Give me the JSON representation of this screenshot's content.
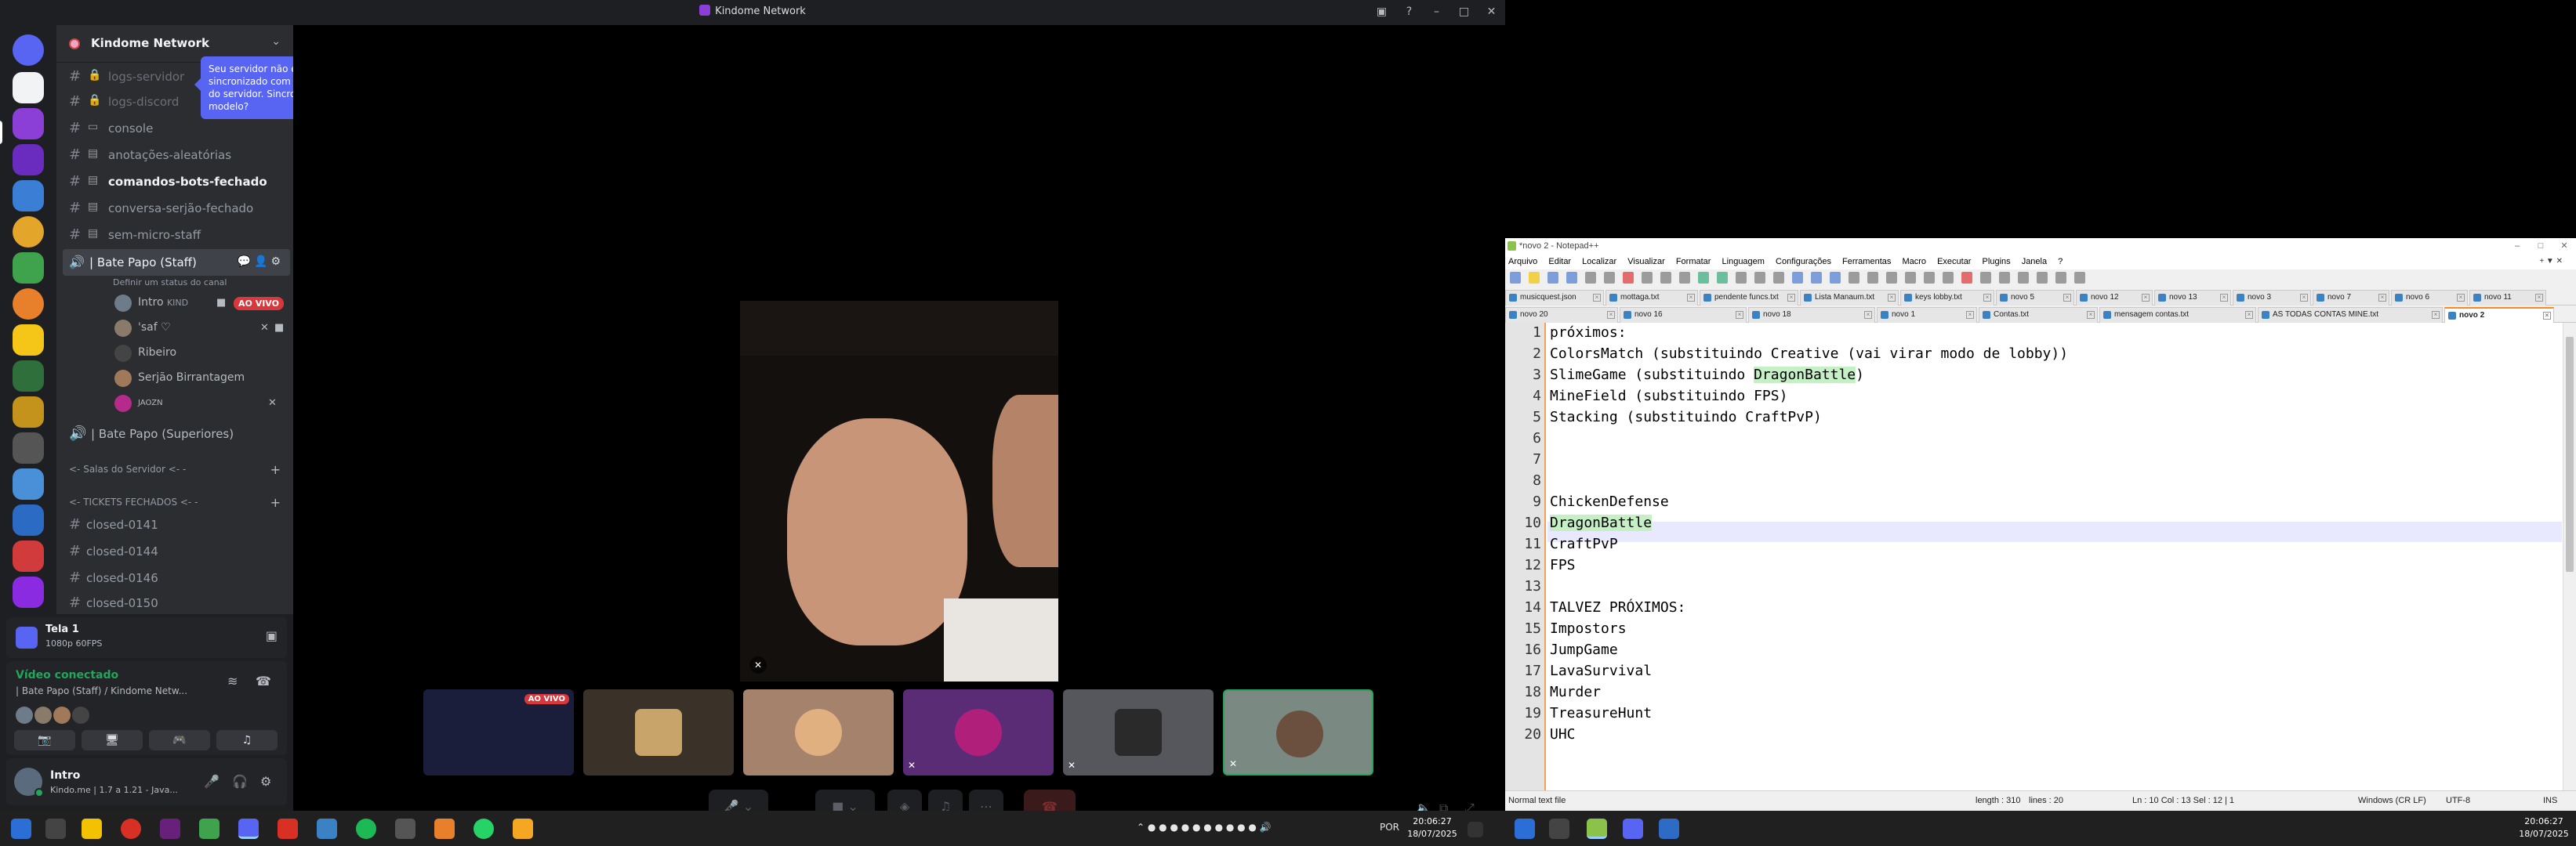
{
  "discord": {
    "window_title": "Kindome Network",
    "server_name": "Kindome Network",
    "tooltip": "Seu servidor não está sincronizado com o modelo do servidor. Sincronizar modelo?",
    "channels": [
      {
        "label": "logs-servidor",
        "locked": true
      },
      {
        "label": "logs-discord",
        "locked": true
      },
      {
        "label": "console",
        "locked": false
      },
      {
        "label": "anotações-aleatórias",
        "locked": false
      },
      {
        "label": "comandos-bots-fechado",
        "locked": false
      },
      {
        "label": "conversa-serjão-fechado",
        "locked": false
      },
      {
        "label": "sem-micro-staff",
        "locked": false
      }
    ],
    "voice_channel": {
      "label": "| Bate Papo (Staff)",
      "status_hint": "Definir um status do canal",
      "users": [
        {
          "name": "Intro",
          "tag": "KIND",
          "live": "AO VIVO"
        },
        {
          "name": "'saf ♡",
          "tag": "",
          "live": ""
        },
        {
          "name": "Ribeiro",
          "tag": "",
          "live": ""
        },
        {
          "name": "Serjão Birrantagem",
          "tag": "",
          "live": ""
        },
        {
          "name": "JAOZN",
          "tag": "",
          "live": ""
        }
      ]
    },
    "voice_channel_2": "| Bate Papo (Superiores)",
    "categories": {
      "salas": "<- Salas do Servidor <- -",
      "tickets": "<- TICKETS FECHADOS <- -"
    },
    "closed_channels": [
      "closed-0141",
      "closed-0144",
      "closed-0146",
      "closed-0150"
    ],
    "screen_share": {
      "title": "Tela 1",
      "subtitle": "1080p 60FPS"
    },
    "voice_connection": {
      "status": "Vídeo conectado",
      "channel": "| Bate Papo (Staff) / Kindome Netw..."
    },
    "user": {
      "name": "Intro",
      "status": "Kindo.me | 1.7 a 1.21 - Java..."
    },
    "tile_live": "AO VIVO",
    "colors": {
      "accent": "#5865f2",
      "live": "#da373c",
      "connected": "#23a55a"
    }
  },
  "notepad": {
    "title": "*novo 2 - Notepad++",
    "menu": [
      "Arquivo",
      "Editar",
      "Localizar",
      "Visualizar",
      "Formatar",
      "Linguagem",
      "Configurações",
      "Ferramentas",
      "Macro",
      "Executar",
      "Plugins",
      "Janela",
      "?"
    ],
    "tabs_row1": [
      "musicquest.json",
      "mottaga.txt",
      "pendente funcs.txt",
      "Lista Manaum.txt",
      "keys lobby.txt",
      "novo 5",
      "novo 12",
      "novo 13",
      "novo 3",
      "novo 7",
      "novo 6",
      "novo 11"
    ],
    "tabs_row2": [
      "novo 20",
      "novo 16",
      "novo 18",
      "novo 1",
      "Contas.txt",
      "mensagem contas.txt",
      "AS TODAS CONTAS MINE.txt",
      "novo 2"
    ],
    "active_tab": "novo 2",
    "lines": [
      "próximos:",
      "ColorsMatch (substituindo Creative (vai virar modo de lobby))",
      "SlimeGame (substituindo DragonBattle)",
      "MineField (substituindo FPS)",
      "Stacking (substituindo CraftPvP)",
      "",
      "",
      "",
      "ChickenDefense",
      "DragonBattle",
      "CraftPvP",
      "FPS",
      "",
      "TALVEZ PRÓXIMOS:",
      "Impostors",
      "JumpGame",
      "LavaSurvival",
      "Murder",
      "TreasureHunt",
      "UHC"
    ],
    "current_line": 10,
    "highlight_word": "DragonBattle",
    "status": {
      "type": "Normal text file",
      "length": "length : 310",
      "lines": "lines : 20",
      "position": "Ln : 10    Col : 13    Sel : 12 | 1",
      "eol": "Windows (CR LF)",
      "encoding": "UTF-8",
      "mode": "INS"
    }
  },
  "taskbar_left": {
    "lang": "POR",
    "time": "20:06:27",
    "date": "18/07/2025"
  },
  "taskbar_right": {
    "time": "20:06:27",
    "date": "18/07/2025"
  }
}
